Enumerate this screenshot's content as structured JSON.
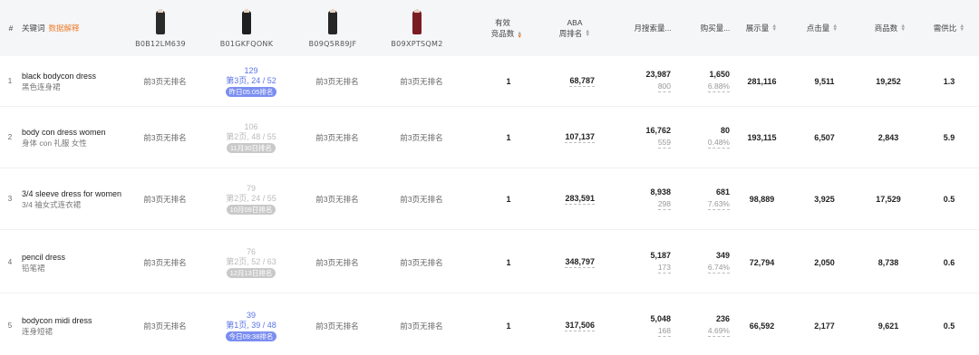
{
  "header": {
    "hash": "#",
    "keyword": "关键词",
    "keyword_link": "数据解释",
    "products": [
      {
        "asin": "B0B12LM639",
        "color": "#2a2a2a"
      },
      {
        "asin": "B01GKFQONK",
        "color": "#1f1f1f"
      },
      {
        "asin": "B09Q5R89JF",
        "color": "#262626"
      },
      {
        "asin": "B09XPTSQM2",
        "color": "#7a1c24"
      }
    ],
    "valid_products": "有效\n竞品数",
    "aba_line1": "ABA",
    "aba_line2": "周排名",
    "monthly_search": "月搜索量...",
    "purchase": "购买量...",
    "impressions": "展示量",
    "clicks": "点击量",
    "product_count": "商品数",
    "supply_ratio": "需供比"
  },
  "rows": [
    {
      "idx": "1",
      "en": "black bodycon dress",
      "cn": "黑色连身裙",
      "ranks": [
        {
          "type": "none",
          "text": "前3页无排名"
        },
        {
          "type": "active",
          "top": "129",
          "mid": "第3页, 24 / 52",
          "pill": "昨日05:05排名",
          "pillStyle": "blue"
        },
        {
          "type": "none",
          "text": "前3页无排名"
        },
        {
          "type": "none",
          "text": "前3页无排名"
        }
      ],
      "valid": "1",
      "aba": "68,787",
      "search": "23,987",
      "search_sub": "800",
      "purchase": "1,650",
      "purchase_sub": "6.88%",
      "impressions": "281,116",
      "clicks": "9,511",
      "product_count": "19,252",
      "ratio": "1.3"
    },
    {
      "idx": "2",
      "en": "body con dress women",
      "cn": "身体 con 礼服 女性",
      "ranks": [
        {
          "type": "none",
          "text": "前3页无排名"
        },
        {
          "type": "muted",
          "top": "106",
          "mid": "第2页, 48 / 55",
          "pill": "11月30日排名",
          "pillStyle": "grey"
        },
        {
          "type": "none",
          "text": "前3页无排名"
        },
        {
          "type": "none",
          "text": "前3页无排名"
        }
      ],
      "valid": "1",
      "aba": "107,137",
      "search": "16,762",
      "search_sub": "559",
      "purchase": "80",
      "purchase_sub": "0.48%",
      "impressions": "193,115",
      "clicks": "6,507",
      "product_count": "2,843",
      "ratio": "5.9"
    },
    {
      "idx": "3",
      "en": "3/4 sleeve dress for women",
      "cn": "3/4 袖女式连衣裙",
      "ranks": [
        {
          "type": "none",
          "text": "前3页无排名"
        },
        {
          "type": "muted",
          "top": "79",
          "mid": "第2页, 24 / 55",
          "pill": "10月09日排名",
          "pillStyle": "grey"
        },
        {
          "type": "none",
          "text": "前3页无排名"
        },
        {
          "type": "none",
          "text": "前3页无排名"
        }
      ],
      "valid": "1",
      "aba": "283,591",
      "search": "8,938",
      "search_sub": "298",
      "purchase": "681",
      "purchase_sub": "7.63%",
      "impressions": "98,889",
      "clicks": "3,925",
      "product_count": "17,529",
      "ratio": "0.5"
    },
    {
      "idx": "4",
      "en": "pencil dress",
      "cn": "铅笔裙",
      "ranks": [
        {
          "type": "none",
          "text": "前3页无排名"
        },
        {
          "type": "muted",
          "top": "76",
          "mid": "第2页, 52 / 63",
          "pill": "12月13日排名",
          "pillStyle": "grey"
        },
        {
          "type": "none",
          "text": "前3页无排名"
        },
        {
          "type": "none",
          "text": "前3页无排名"
        }
      ],
      "valid": "1",
      "aba": "348,797",
      "search": "5,187",
      "search_sub": "173",
      "purchase": "349",
      "purchase_sub": "6.74%",
      "impressions": "72,794",
      "clicks": "2,050",
      "product_count": "8,738",
      "ratio": "0.6"
    },
    {
      "idx": "5",
      "en": "bodycon midi dress",
      "cn": "连身短裙",
      "ranks": [
        {
          "type": "none",
          "text": "前3页无排名"
        },
        {
          "type": "active",
          "top": "39",
          "mid": "第1页, 39 / 48",
          "pill": "今日09:38排名",
          "pillStyle": "blue"
        },
        {
          "type": "none",
          "text": "前3页无排名"
        },
        {
          "type": "none",
          "text": "前3页无排名"
        }
      ],
      "valid": "1",
      "aba": "317,506",
      "search": "5,048",
      "search_sub": "168",
      "purchase": "236",
      "purchase_sub": "4.69%",
      "impressions": "66,592",
      "clicks": "2,177",
      "product_count": "9,621",
      "ratio": "0.5"
    }
  ]
}
